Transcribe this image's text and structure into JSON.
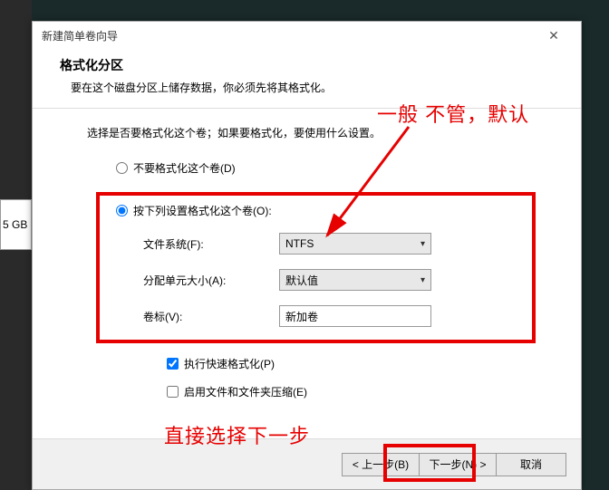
{
  "bg_fragment": "5 GB",
  "dialog": {
    "title": "新建简单卷向导",
    "header_title": "格式化分区",
    "header_desc": "要在这个磁盘分区上储存数据，你必须先将其格式化。",
    "instruction": "选择是否要格式化这个卷；如果要格式化，要使用什么设置。",
    "radio_no_format": "不要格式化这个卷(D)",
    "radio_format": "按下列设置格式化这个卷(O):",
    "fs_label": "文件系统(F):",
    "fs_value": "NTFS",
    "alloc_label": "分配单元大小(A):",
    "alloc_value": "默认值",
    "vol_label": "卷标(V):",
    "vol_value": "新加卷",
    "quick_format": "执行快速格式化(P)",
    "compression": "启用文件和文件夹压缩(E)",
    "back": "< 上一步(B)",
    "next": "下一步(N) >",
    "cancel": "取消"
  },
  "annotation1": "一般 不管，默认",
  "annotation2": "直接选择下一步"
}
